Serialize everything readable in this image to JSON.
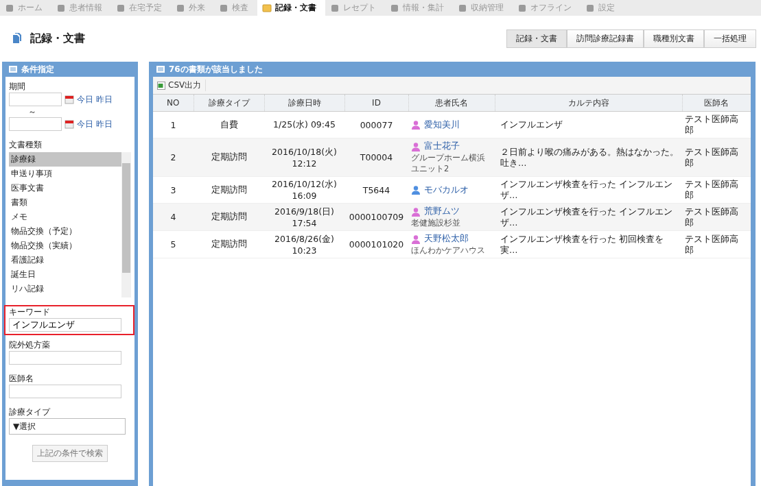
{
  "nav_tabs": [
    {
      "label": "ホーム",
      "selected": false
    },
    {
      "label": "患者情報",
      "selected": false
    },
    {
      "label": "在宅予定",
      "selected": false
    },
    {
      "label": "外来",
      "selected": false
    },
    {
      "label": "検査",
      "selected": false
    },
    {
      "label": "記録・文書",
      "selected": true
    },
    {
      "label": "レセプト",
      "selected": false
    },
    {
      "label": "情報・集計",
      "selected": false
    },
    {
      "label": "収納管理",
      "selected": false
    },
    {
      "label": "オフライン",
      "selected": false
    },
    {
      "label": "設定",
      "selected": false
    }
  ],
  "page_title": "記録・文書",
  "sub_tabs": [
    {
      "label": "記録・文書",
      "selected": true
    },
    {
      "label": "訪問診療記録書",
      "selected": false
    },
    {
      "label": "職種別文書",
      "selected": false
    },
    {
      "label": "一括処理",
      "selected": false
    }
  ],
  "filter_panel": {
    "title": "条件指定",
    "period_label": "期間",
    "date_ranges": [
      {
        "today": "今日",
        "yesterday": "昨日"
      },
      {
        "today": "今日",
        "yesterday": "昨日"
      }
    ],
    "range_sep": "～",
    "doc_type_label": "文書種類",
    "doc_types": [
      {
        "label": "診療録",
        "selected": true
      },
      {
        "label": "申送り事項",
        "selected": false
      },
      {
        "label": "医事文書",
        "selected": false
      },
      {
        "label": "書類",
        "selected": false
      },
      {
        "label": "メモ",
        "selected": false
      },
      {
        "label": "物品交換（予定）",
        "selected": false
      },
      {
        "label": "物品交換（実績）",
        "selected": false
      },
      {
        "label": "看護記録",
        "selected": false
      },
      {
        "label": "誕生日",
        "selected": false
      },
      {
        "label": "リハ記録",
        "selected": false
      }
    ],
    "keyword_label": "キーワード",
    "keyword_value": "インフルエンザ",
    "prescription_label": "院外処方薬",
    "doctor_label": "医師名",
    "type_label": "診療タイプ",
    "type_select": "▼選択",
    "search_button": "上記の条件で検索"
  },
  "results": {
    "title": "76の書類が該当しました",
    "csv_button": "CSV出力",
    "columns": [
      "NO",
      "診療タイプ",
      "診療日時",
      "ID",
      "患者氏名",
      "カルテ内容",
      "医師名"
    ],
    "rows": [
      {
        "no": "1",
        "type": "自費",
        "date": "1/25(水) 09:45",
        "id": "000077",
        "patient": "愛知美川",
        "color": "#d96fd6",
        "content": "インフルエンザ",
        "doctor": "テスト医師高郎"
      },
      {
        "no": "2",
        "type": "定期訪問",
        "date": "2016/10/18(火) 12:12",
        "id": "T00004",
        "patient": "富士花子",
        "facility": "グループホーム横浜ユニット2",
        "color": "#d96fd6",
        "content": "２日前より喉の痛みがある。熱はなかった。吐き…",
        "doctor": "テスト医師高郎"
      },
      {
        "no": "3",
        "type": "定期訪問",
        "date": "2016/10/12(水) 16:09",
        "id": "T5644",
        "patient": "モバカルオ",
        "color": "#4f8fe0",
        "content": "インフルエンザ検査を行った インフルエンザ…",
        "doctor": "テスト医師高郎"
      },
      {
        "no": "4",
        "type": "定期訪問",
        "date": "2016/9/18(日) 17:54",
        "id": "0000100709",
        "patient": "荒野ムツ",
        "facility": "老健施設杉並",
        "color": "#d96fd6",
        "content": "インフルエンザ検査を行った インフルエンザ…",
        "doctor": "テスト医師高郎"
      },
      {
        "no": "5",
        "type": "定期訪問",
        "date": "2016/8/26(金) 10:23",
        "id": "0000101020",
        "patient": "天野松太郎",
        "facility": "ほんわかケアハウス",
        "color": "#d96fd6",
        "content": "インフルエンザ検査を行った 初回検査を実…",
        "doctor": "テスト医師高郎"
      }
    ]
  }
}
